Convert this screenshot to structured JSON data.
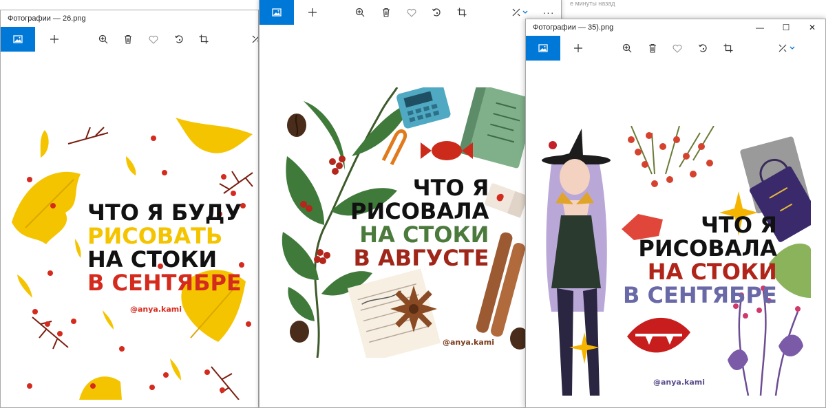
{
  "background_status": "е минуты назад",
  "colors": {
    "accent": "#0078d7",
    "yellow": "#f5c400",
    "red": "#d52b1e",
    "green": "#4c7a3c",
    "darkred": "#a0261a",
    "purple": "#6a69a8",
    "black": "#111111"
  },
  "windows": [
    {
      "title": "Фотографии — 26.png",
      "toolbar_icons": [
        "photo-icon",
        "plus-icon",
        "zoom-in-icon",
        "trash-icon",
        "heart-icon",
        "rotate-icon",
        "crop-icon",
        "edit-icon"
      ],
      "poster": {
        "lines": [
          "ЧТО Я БУДУ",
          "РИСОВАТЬ",
          "НА СТОКИ",
          "В СЕНТЯБРЕ"
        ],
        "handle": "@anya.kami"
      }
    },
    {
      "title": "",
      "toolbar_icons": [
        "photo-icon",
        "plus-icon",
        "zoom-in-icon",
        "trash-icon",
        "heart-icon",
        "rotate-icon",
        "crop-icon",
        "edit-icon",
        "chevron-down-icon",
        "more-icon"
      ],
      "more": "···",
      "poster": {
        "lines": [
          "ЧТО Я",
          "РИСОВАЛА",
          "НА СТОКИ",
          "В АВГУСТЕ"
        ],
        "handle": "@anya.kami"
      }
    },
    {
      "title": "Фотографии — 35).png",
      "controls": {
        "minimize": "—",
        "maximize": "☐",
        "close": "✕"
      },
      "toolbar_icons": [
        "photo-icon",
        "plus-icon",
        "zoom-in-icon",
        "trash-icon",
        "heart-icon",
        "rotate-icon",
        "crop-icon",
        "edit-icon",
        "chevron-down-icon"
      ],
      "poster": {
        "lines": [
          "ЧТО Я",
          "РИСОВАЛА",
          "НА СТОКИ",
          "В СЕНТЯБРЕ"
        ],
        "handle": "@anya.kami"
      }
    }
  ]
}
